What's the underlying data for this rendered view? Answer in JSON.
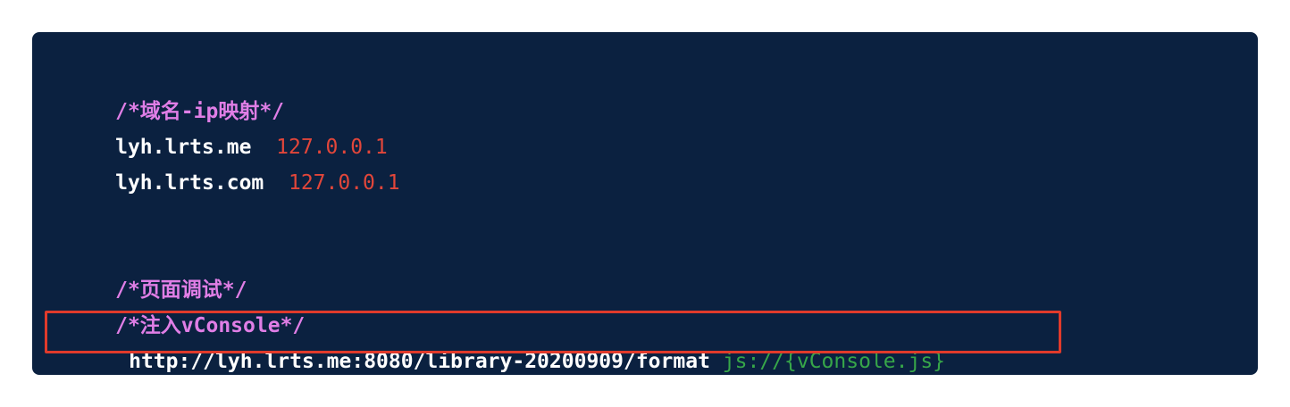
{
  "code_block": {
    "lines": [
      {
        "type": "comment",
        "text": "/*域名-ip映射*/"
      },
      {
        "type": "mapping",
        "host": "lyh.lrts.me",
        "sep": "  ",
        "ip": "127.0.0.1"
      },
      {
        "type": "mapping",
        "host": "lyh.lrts.com",
        "sep": "  ",
        "ip": "127.0.0.1"
      },
      {
        "type": "comment",
        "text": "/*页面调试*/"
      },
      {
        "type": "comment",
        "text": "/*注入vConsole*/"
      },
      {
        "type": "rule",
        "url": "http://lyh.lrts.me:8080/library-20200909/format",
        "sep": " ",
        "action": "js://{vConsole.js}"
      }
    ]
  },
  "colors": {
    "background": "#0b2140",
    "comment": "#e07ee6",
    "ip": "#e2463a",
    "plugin": "#37a649",
    "highlight_border": "#e03a2b"
  }
}
